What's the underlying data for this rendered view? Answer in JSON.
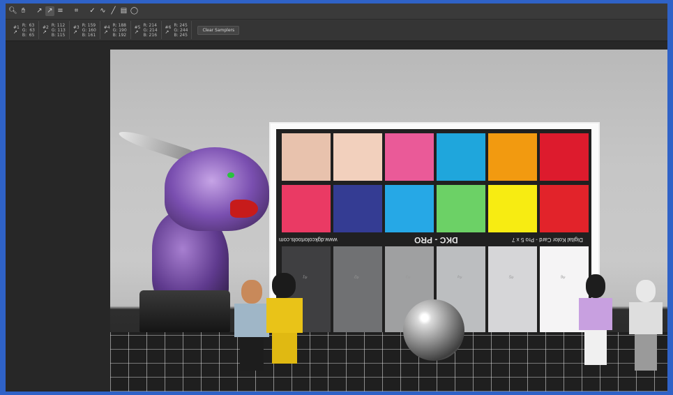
{
  "toolbar": {
    "tools": [
      "zoom-icon",
      "hand-icon",
      "eyedropper-icon",
      "color-sampler-icon",
      "ruler-icon",
      "crop-icon",
      "brush-icon",
      "healing-icon",
      "pencil-icon",
      "eraser-icon",
      "lasso-icon"
    ]
  },
  "samplers": [
    {
      "id": "#1",
      "r": "R:  63",
      "g": "G:  63",
      "b": "B:  65"
    },
    {
      "id": "#2",
      "r": "R: 112",
      "g": "G: 113",
      "b": "B: 115"
    },
    {
      "id": "#3",
      "r": "R: 159",
      "g": "G: 160",
      "b": "B: 161"
    },
    {
      "id": "#4",
      "r": "R: 188",
      "g": "G: 190",
      "b": "B: 192"
    },
    {
      "id": "#5",
      "r": "R: 214",
      "g": "G: 214",
      "b": "B: 216"
    },
    {
      "id": "#6",
      "r": "R: 245",
      "g": "G: 244",
      "b": "B: 245"
    }
  ],
  "clear_samplers_label": "Clear Samplers",
  "card": {
    "title": "DKC - PRO",
    "website": "www.dgkcolortools.com",
    "subtitle": "Digital Kolor Card - Pro 5 x 7",
    "top_row_colors": [
      "#e8c2ad",
      "#f2d0bd",
      "#ea5a98",
      "#1fa6dc",
      "#f29a10",
      "#dd1b2d"
    ],
    "middle_row_colors": [
      "#ea3a64",
      "#343c93",
      "#26a8e6",
      "#6cd166",
      "#f7ec12",
      "#e2232a"
    ],
    "gray_colors": [
      "#3f3f41",
      "#707173",
      "#9fa0a1",
      "#bcbec0",
      "#d6d6d8",
      "#f5f4f5"
    ],
    "gray_labels": [
      "#1",
      "#2",
      "#3",
      "#4",
      "#5",
      "#6"
    ]
  }
}
